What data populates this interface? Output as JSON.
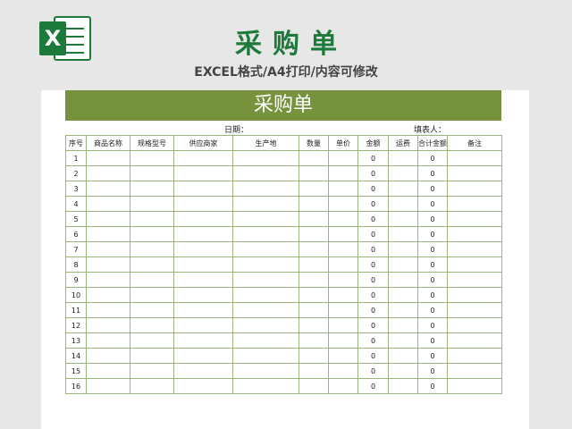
{
  "logo": {
    "letter": "X"
  },
  "page": {
    "title": "采购单",
    "subtitle": "EXCEL格式/A4打印/内容可修改"
  },
  "sheet": {
    "title": "采购单",
    "date_label": "日期：",
    "filler_label": "填表人：",
    "columns": [
      "序号",
      "商品名称",
      "规格型号",
      "供应商家",
      "生产地",
      "数量",
      "单价",
      "金额",
      "运费",
      "合计金额",
      "备注"
    ],
    "rows": [
      {
        "no": "1",
        "amount": "0",
        "total": "0"
      },
      {
        "no": "2",
        "amount": "0",
        "total": "0"
      },
      {
        "no": "3",
        "amount": "0",
        "total": "0"
      },
      {
        "no": "4",
        "amount": "0",
        "total": "0"
      },
      {
        "no": "5",
        "amount": "0",
        "total": "0"
      },
      {
        "no": "6",
        "amount": "0",
        "total": "0"
      },
      {
        "no": "7",
        "amount": "0",
        "total": "0"
      },
      {
        "no": "8",
        "amount": "0",
        "total": "0"
      },
      {
        "no": "9",
        "amount": "0",
        "total": "0"
      },
      {
        "no": "10",
        "amount": "0",
        "total": "0"
      },
      {
        "no": "11",
        "amount": "0",
        "total": "0"
      },
      {
        "no": "12",
        "amount": "0",
        "total": "0"
      },
      {
        "no": "13",
        "amount": "0",
        "total": "0"
      },
      {
        "no": "14",
        "amount": "0",
        "total": "0"
      },
      {
        "no": "15",
        "amount": "0",
        "total": "0"
      },
      {
        "no": "16",
        "amount": "0",
        "total": "0"
      }
    ]
  },
  "colors": {
    "brand_green": "#1e7a3a",
    "header_green": "#76923c",
    "grid_line": "#9bb37c",
    "background": "#e7e7e7"
  }
}
